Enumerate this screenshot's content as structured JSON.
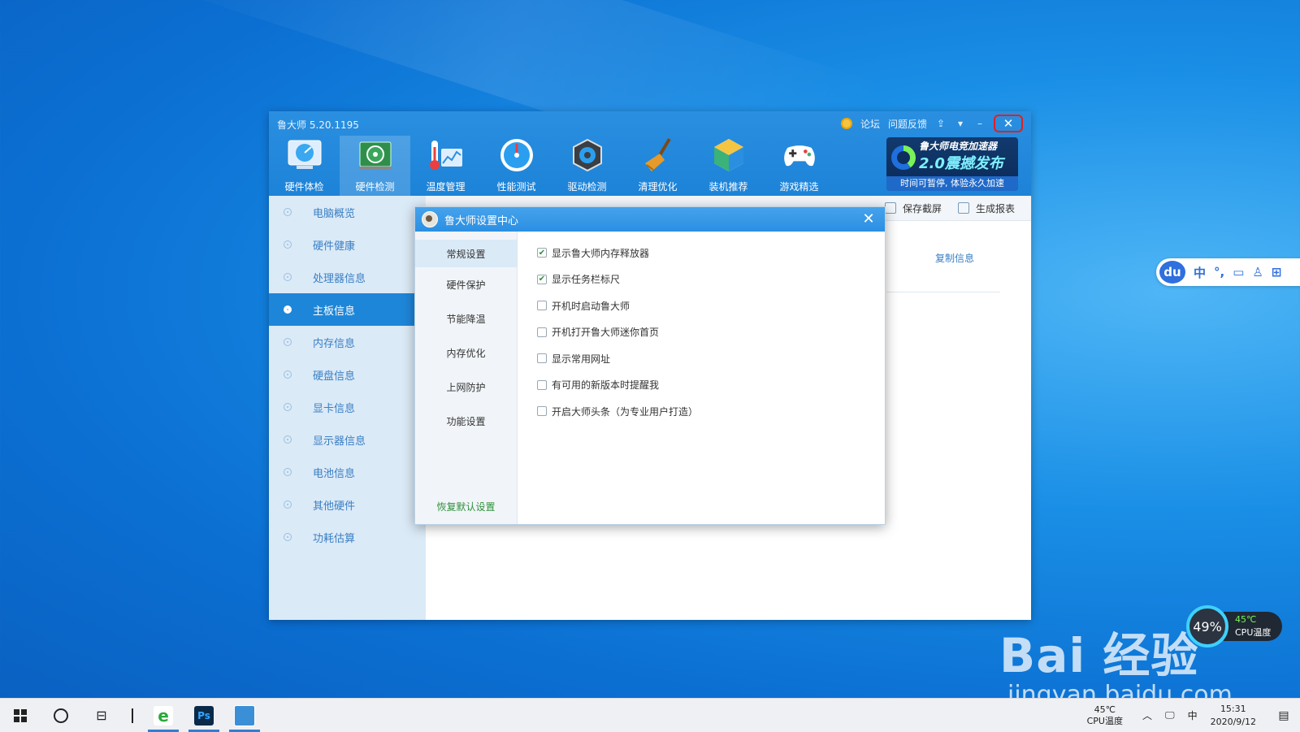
{
  "window": {
    "title": "鲁大师 5.20.1195",
    "actions": {
      "forum": "论坛",
      "feedback": "问题反馈",
      "minimize": "–",
      "close": "✕"
    }
  },
  "toolbar": [
    {
      "label": "硬件体检",
      "icon": "speedometer-icon"
    },
    {
      "label": "硬件检测",
      "icon": "hardware-board-icon"
    },
    {
      "label": "温度管理",
      "icon": "thermometer-icon"
    },
    {
      "label": "性能测试",
      "icon": "performance-gauge-icon"
    },
    {
      "label": "驱动检测",
      "icon": "driver-gear-icon"
    },
    {
      "label": "清理优化",
      "icon": "broom-icon"
    },
    {
      "label": "装机推荐",
      "icon": "cube-icon"
    },
    {
      "label": "游戏精选",
      "icon": "gamepad-icon"
    }
  ],
  "banner": {
    "line1": "鲁大师电竞加速器",
    "line2": "2.0震撼发布",
    "line3": "时间可暂停, 体验永久加速"
  },
  "sidebar": {
    "items": [
      {
        "label": "电脑概览"
      },
      {
        "label": "硬件健康"
      },
      {
        "label": "处理器信息"
      },
      {
        "label": "主板信息"
      },
      {
        "label": "内存信息"
      },
      {
        "label": "硬盘信息"
      },
      {
        "label": "显卡信息"
      },
      {
        "label": "显示器信息"
      },
      {
        "label": "电池信息"
      },
      {
        "label": "其他硬件"
      },
      {
        "label": "功耗估算"
      }
    ],
    "active_index": 3
  },
  "main": {
    "actions": {
      "save_screen": "保存截屏",
      "report": "生成报表"
    },
    "copy_info": "复制信息"
  },
  "dialog": {
    "title": "鲁大师设置中心",
    "close": "✕",
    "nav": [
      "常规设置",
      "硬件保护",
      "节能降温",
      "内存优化",
      "上网防护",
      "功能设置"
    ],
    "reset": "恢复默认设置",
    "options": [
      {
        "label": "显示鲁大师内存释放器",
        "checked": true
      },
      {
        "label": "显示任务栏标尺",
        "checked": true
      },
      {
        "label": "开机时启动鲁大师",
        "checked": false
      },
      {
        "label": "开机打开鲁大师迷你首页",
        "checked": false
      },
      {
        "label": "显示常用网址",
        "checked": false
      },
      {
        "label": "有可用的新版本时提醒我",
        "checked": false
      },
      {
        "label": "开启大师头条（为专业用户打造）",
        "checked": false
      }
    ]
  },
  "ime": {
    "logo": "du",
    "mode": "中",
    "punct": "°,"
  },
  "cpu_widget": {
    "percent": "49%",
    "temp": "45℃",
    "label": "CPU温度"
  },
  "watermark": {
    "line1": "Bai   经验",
    "line2": "jingyan.baidu.com"
  },
  "taskbar": {
    "cpu_temp": "45℃",
    "cpu_label": "CPU温度",
    "time": "15:31",
    "date": "2020/9/12",
    "lang": "中",
    "ps_label": "Ps"
  }
}
